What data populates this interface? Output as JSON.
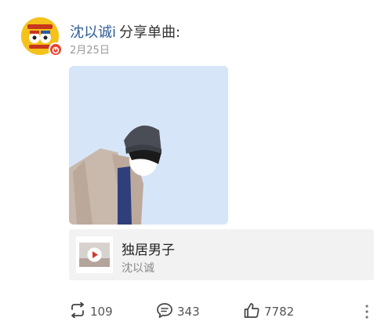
{
  "post": {
    "username": "沈以诚i",
    "action_text": "分享单曲:",
    "date": "2月25日"
  },
  "music": {
    "title": "独居男子",
    "artist": "沈以诚"
  },
  "actions": {
    "repost_count": "109",
    "comment_count": "343",
    "like_count": "7782"
  },
  "icons": {
    "repost": "repost-icon",
    "comment": "comment-icon",
    "like": "like-icon",
    "more": "more-vertical-icon",
    "play": "play-icon"
  },
  "colors": {
    "username": "#2d5b96",
    "avatar_bg": "#f4c21b",
    "cover_bg": "#d6e6f8",
    "card_bg": "#f2f2f2"
  }
}
